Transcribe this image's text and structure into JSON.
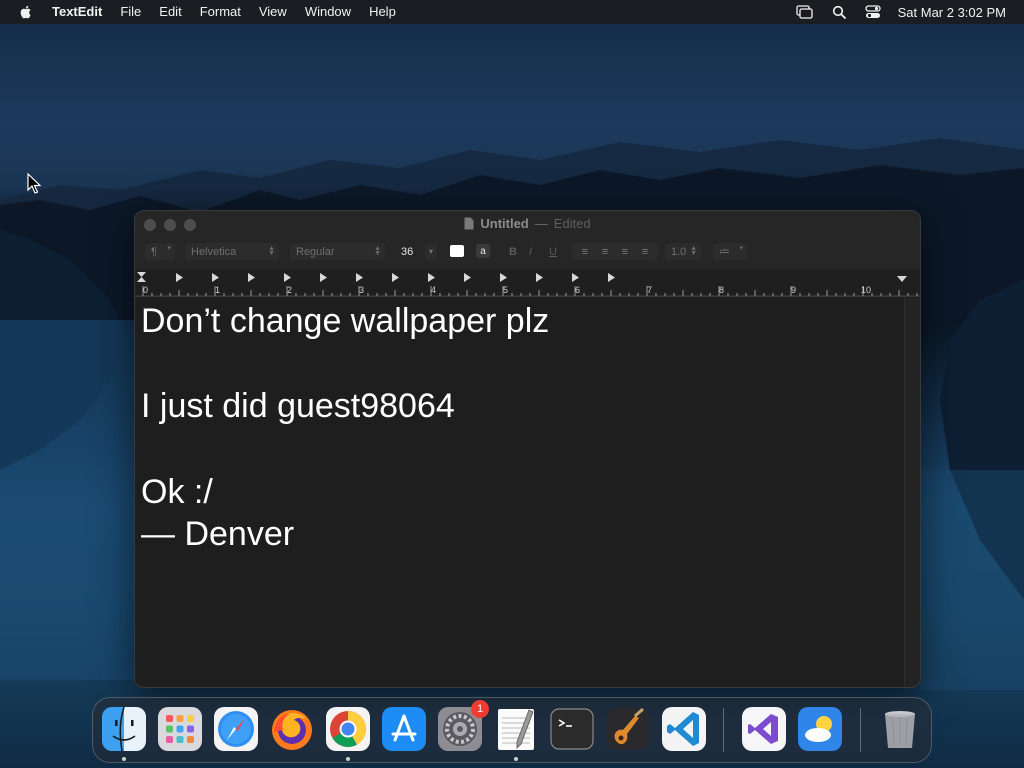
{
  "menubar": {
    "app_name": "TextEdit",
    "menus": [
      "File",
      "Edit",
      "Format",
      "View",
      "Window",
      "Help"
    ],
    "clock": "Sat Mar 2  3:02 PM",
    "status_icons": [
      "screen-mirroring-icon",
      "search-icon",
      "control-center-icon"
    ]
  },
  "window": {
    "title": "Untitled",
    "title_separator": "—",
    "title_status": "Edited",
    "toolbar": {
      "paragraph_style": "¶",
      "font_family": "Helvetica",
      "font_style": "Regular",
      "font_size": "36",
      "text_color": "#ffffff",
      "background_label": "a",
      "bold_label": "B",
      "italic_label": "I",
      "underline_label": "U",
      "line_spacing": "1.0",
      "list_label": "≔"
    },
    "ruler": {
      "numbers": [
        "0",
        "1",
        "2",
        "3",
        "4",
        "5",
        "6",
        "7",
        "8",
        "9",
        "10"
      ]
    },
    "document_lines": [
      "Don’t change wallpaper plz",
      "",
      "I just did guest98064",
      "",
      "Ok :/",
      "— Denver"
    ]
  },
  "dock": {
    "apps": [
      {
        "name": "Finder",
        "running": true
      },
      {
        "name": "Launchpad",
        "running": false
      },
      {
        "name": "Safari",
        "running": false
      },
      {
        "name": "Firefox",
        "running": false
      },
      {
        "name": "Google Chrome",
        "running": true
      },
      {
        "name": "App Store",
        "running": false
      },
      {
        "name": "System Settings",
        "running": false,
        "badge": "1"
      },
      {
        "name": "TextEdit",
        "running": true
      },
      {
        "name": "Terminal",
        "running": false
      },
      {
        "name": "GarageBand",
        "running": false
      },
      {
        "name": "Visual Studio Code",
        "running": false
      },
      {
        "name": "Visual Studio",
        "running": false
      },
      {
        "name": "Weather",
        "running": false
      },
      {
        "name": "Trash",
        "running": false
      }
    ]
  },
  "colors": {
    "menubar_bg": "#1c1c20",
    "window_bg": "#1e1e1e",
    "badge_red": "#f23b30"
  }
}
